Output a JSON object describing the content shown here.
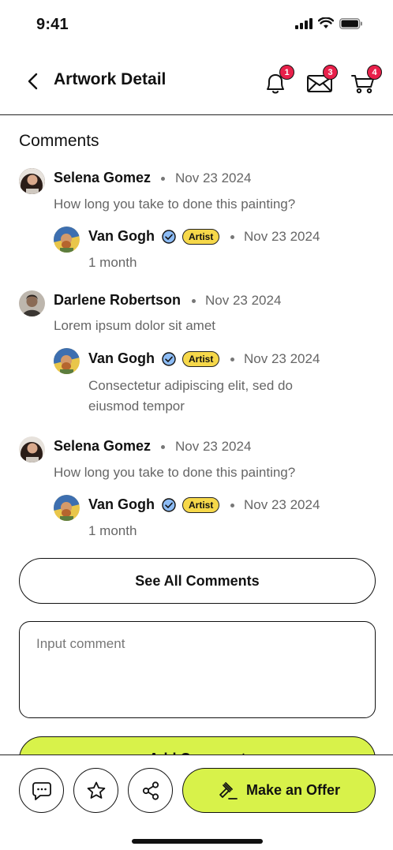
{
  "status": {
    "time": "9:41"
  },
  "header": {
    "title": "Artwork Detail",
    "badges": {
      "notifications": "1",
      "messages": "3",
      "cart": "4"
    }
  },
  "comments_section": {
    "title": "Comments",
    "threads": [
      {
        "name": "Selena Gomez",
        "date": "Nov 23 2024",
        "text": "How long you take to done this painting?",
        "reply": {
          "name": "Van Gogh",
          "tag": "Artist",
          "date": "Nov 23 2024",
          "text": "1 month"
        }
      },
      {
        "name": "Darlene Robertson",
        "date": "Nov 23 2024",
        "text": "Lorem ipsum dolor sit amet",
        "reply": {
          "name": "Van Gogh",
          "tag": "Artist",
          "date": "Nov 23 2024",
          "text": "Consectetur adipiscing elit, sed do eiusmod tempor"
        }
      },
      {
        "name": "Selena Gomez",
        "date": "Nov 23 2024",
        "text": "How long you take to done this painting?",
        "reply": {
          "name": "Van Gogh",
          "tag": "Artist",
          "date": "Nov 23 2024",
          "text": "1 month"
        }
      }
    ],
    "see_all_label": "See All Comments",
    "input_placeholder": "Input comment",
    "add_comment_label": "Add Comment"
  },
  "bottom_bar": {
    "offer_label": "Make an Offer"
  },
  "colors": {
    "accent": "#d8f24a",
    "badge": "#e8204a",
    "artist_tag": "#f6d84a",
    "verified": "#4a8ef0"
  },
  "icons": [
    "back-icon",
    "bell-icon",
    "mail-icon",
    "cart-icon",
    "verified-icon",
    "chat-icon",
    "star-icon",
    "share-icon",
    "gavel-icon"
  ]
}
